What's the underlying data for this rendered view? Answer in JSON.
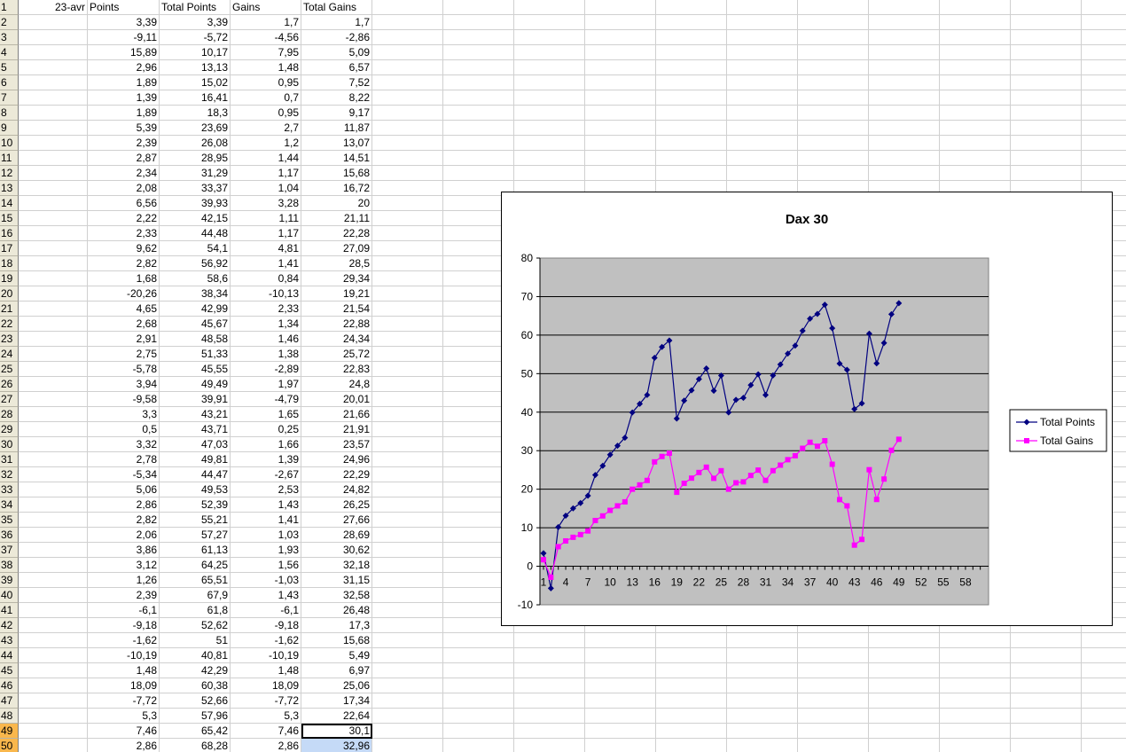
{
  "headers": {
    "A": "",
    "B": "23-avr",
    "C": "Points",
    "D": "Total Points",
    "E": "Gains",
    "F": "Total Gains"
  },
  "row_numbers": [
    "1",
    "2",
    "3",
    "4",
    "5",
    "6",
    "7",
    "8",
    "9",
    "10",
    "11",
    "12",
    "13",
    "14",
    "15",
    "16",
    "17",
    "18",
    "19",
    "20",
    "21",
    "22",
    "23",
    "24",
    "25",
    "26",
    "27",
    "28",
    "29",
    "30",
    "31",
    "32",
    "33",
    "34",
    "35",
    "36",
    "37",
    "38",
    "39",
    "40",
    "41",
    "42",
    "43",
    "44",
    "45",
    "46",
    "47",
    "48",
    "49",
    "50"
  ],
  "rows": [
    [
      "3,39",
      "3,39",
      "1,7",
      "1,7"
    ],
    [
      "-9,11",
      "-5,72",
      "-4,56",
      "-2,86"
    ],
    [
      "15,89",
      "10,17",
      "7,95",
      "5,09"
    ],
    [
      "2,96",
      "13,13",
      "1,48",
      "6,57"
    ],
    [
      "1,89",
      "15,02",
      "0,95",
      "7,52"
    ],
    [
      "1,39",
      "16,41",
      "0,7",
      "8,22"
    ],
    [
      "1,89",
      "18,3",
      "0,95",
      "9,17"
    ],
    [
      "5,39",
      "23,69",
      "2,7",
      "11,87"
    ],
    [
      "2,39",
      "26,08",
      "1,2",
      "13,07"
    ],
    [
      "2,87",
      "28,95",
      "1,44",
      "14,51"
    ],
    [
      "2,34",
      "31,29",
      "1,17",
      "15,68"
    ],
    [
      "2,08",
      "33,37",
      "1,04",
      "16,72"
    ],
    [
      "6,56",
      "39,93",
      "3,28",
      "20"
    ],
    [
      "2,22",
      "42,15",
      "1,11",
      "21,11"
    ],
    [
      "2,33",
      "44,48",
      "1,17",
      "22,28"
    ],
    [
      "9,62",
      "54,1",
      "4,81",
      "27,09"
    ],
    [
      "2,82",
      "56,92",
      "1,41",
      "28,5"
    ],
    [
      "1,68",
      "58,6",
      "0,84",
      "29,34"
    ],
    [
      "-20,26",
      "38,34",
      "-10,13",
      "19,21"
    ],
    [
      "4,65",
      "42,99",
      "2,33",
      "21,54"
    ],
    [
      "2,68",
      "45,67",
      "1,34",
      "22,88"
    ],
    [
      "2,91",
      "48,58",
      "1,46",
      "24,34"
    ],
    [
      "2,75",
      "51,33",
      "1,38",
      "25,72"
    ],
    [
      "-5,78",
      "45,55",
      "-2,89",
      "22,83"
    ],
    [
      "3,94",
      "49,49",
      "1,97",
      "24,8"
    ],
    [
      "-9,58",
      "39,91",
      "-4,79",
      "20,01"
    ],
    [
      "3,3",
      "43,21",
      "1,65",
      "21,66"
    ],
    [
      "0,5",
      "43,71",
      "0,25",
      "21,91"
    ],
    [
      "3,32",
      "47,03",
      "1,66",
      "23,57"
    ],
    [
      "2,78",
      "49,81",
      "1,39",
      "24,96"
    ],
    [
      "-5,34",
      "44,47",
      "-2,67",
      "22,29"
    ],
    [
      "5,06",
      "49,53",
      "2,53",
      "24,82"
    ],
    [
      "2,86",
      "52,39",
      "1,43",
      "26,25"
    ],
    [
      "2,82",
      "55,21",
      "1,41",
      "27,66"
    ],
    [
      "2,06",
      "57,27",
      "1,03",
      "28,69"
    ],
    [
      "3,86",
      "61,13",
      "1,93",
      "30,62"
    ],
    [
      "3,12",
      "64,25",
      "1,56",
      "32,18"
    ],
    [
      "1,26",
      "65,51",
      "-1,03",
      "31,15"
    ],
    [
      "2,39",
      "67,9",
      "1,43",
      "32,58"
    ],
    [
      "-6,1",
      "61,8",
      "-6,1",
      "26,48"
    ],
    [
      "-9,18",
      "52,62",
      "-9,18",
      "17,3"
    ],
    [
      "-1,62",
      "51",
      "-1,62",
      "15,68"
    ],
    [
      "-10,19",
      "40,81",
      "-10,19",
      "5,49"
    ],
    [
      "1,48",
      "42,29",
      "1,48",
      "6,97"
    ],
    [
      "18,09",
      "60,38",
      "18,09",
      "25,06"
    ],
    [
      "-7,72",
      "52,66",
      "-7,72",
      "17,34"
    ],
    [
      "5,3",
      "57,96",
      "5,3",
      "22,64"
    ],
    [
      "7,46",
      "65,42",
      "7,46",
      "30,1"
    ],
    [
      "2,86",
      "68,28",
      "2,86",
      "32,96"
    ]
  ],
  "colors": {
    "total_points": "#000080",
    "total_gains": "#ff00ff",
    "plot_bg": "#c0c0c0"
  },
  "chart_data": {
    "type": "line",
    "title": "Dax 30",
    "xlabel": "",
    "ylabel": "",
    "ylim": [
      -10,
      80
    ],
    "yticks": [
      "80",
      "70",
      "60",
      "50",
      "40",
      "30",
      "20",
      "10",
      "0",
      "-10"
    ],
    "xtick_labels": [
      "1",
      "4",
      "7",
      "10",
      "13",
      "16",
      "19",
      "22",
      "25",
      "28",
      "31",
      "34",
      "37",
      "40",
      "43",
      "46",
      "49",
      "52",
      "55",
      "58"
    ],
    "xlim": [
      1,
      60
    ],
    "grid": true,
    "legend_position": "right",
    "series": [
      {
        "name": "Total Points",
        "marker": "diamond",
        "values": [
          3.39,
          -5.72,
          10.17,
          13.13,
          15.02,
          16.41,
          18.3,
          23.69,
          26.08,
          28.95,
          31.29,
          33.37,
          39.93,
          42.15,
          44.48,
          54.1,
          56.92,
          58.6,
          38.34,
          42.99,
          45.67,
          48.58,
          51.33,
          45.55,
          49.49,
          39.91,
          43.21,
          43.71,
          47.03,
          49.81,
          44.47,
          49.53,
          52.39,
          55.21,
          57.27,
          61.13,
          64.25,
          65.51,
          67.9,
          61.8,
          52.62,
          51,
          40.81,
          42.29,
          60.38,
          52.66,
          57.96,
          65.42,
          68.28
        ]
      },
      {
        "name": "Total Gains",
        "marker": "square",
        "values": [
          1.7,
          -2.86,
          5.09,
          6.57,
          7.52,
          8.22,
          9.17,
          11.87,
          13.07,
          14.51,
          15.68,
          16.72,
          20,
          21.11,
          22.28,
          27.09,
          28.5,
          29.34,
          19.21,
          21.54,
          22.88,
          24.34,
          25.72,
          22.83,
          24.8,
          20.01,
          21.66,
          21.91,
          23.57,
          24.96,
          22.29,
          24.82,
          26.25,
          27.66,
          28.69,
          30.62,
          32.18,
          31.15,
          32.58,
          26.48,
          17.3,
          15.68,
          5.49,
          6.97,
          25.06,
          17.34,
          22.64,
          30.1,
          32.96
        ]
      }
    ]
  }
}
